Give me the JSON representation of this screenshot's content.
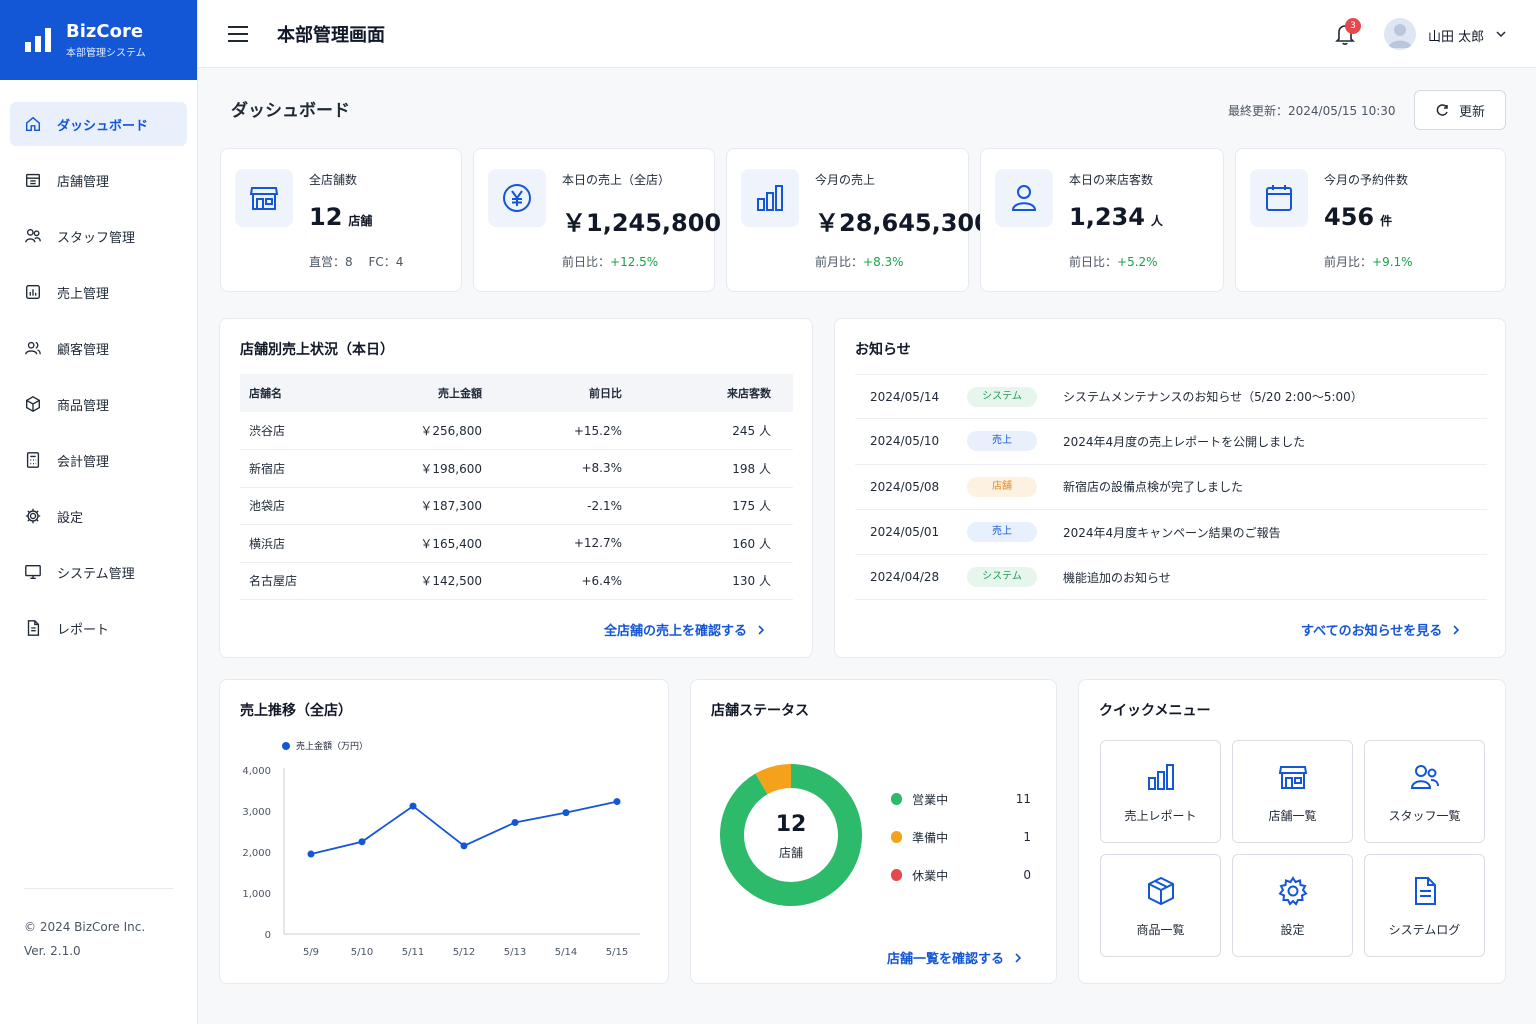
{
  "app": {
    "name": "BizCore",
    "subtitle": "本部管理システム"
  },
  "header": {
    "title": "本部管理画面",
    "notification_count": "3",
    "user_name": "山田 太郎"
  },
  "sidebar": {
    "items": [
      {
        "label": "ダッシュボード",
        "icon": "home-icon",
        "active": true
      },
      {
        "label": "店舗管理",
        "icon": "store-icon"
      },
      {
        "label": "スタッフ管理",
        "icon": "staff-icon"
      },
      {
        "label": "売上管理",
        "icon": "sales-chart-icon"
      },
      {
        "label": "顧客管理",
        "icon": "customers-icon"
      },
      {
        "label": "商品管理",
        "icon": "box-icon"
      },
      {
        "label": "会計管理",
        "icon": "calculator-icon"
      },
      {
        "label": "設定",
        "icon": "gear-icon"
      },
      {
        "label": "システム管理",
        "icon": "monitor-icon"
      },
      {
        "label": "レポート",
        "icon": "document-icon"
      }
    ],
    "copyright": "© 2024 BizCore Inc.",
    "version": "Ver. 2.1.0"
  },
  "page": {
    "title": "ダッシュボード",
    "last_updated": "最終更新：2024/05/15 10:30",
    "refresh_label": "更新"
  },
  "stats": [
    {
      "label": "全店舗数",
      "value": "12",
      "unit": "店舗",
      "sub": "直営：8　 FC：4",
      "icon": "store-icon"
    },
    {
      "label": "本日の売上（全店）",
      "value": "￥1,245,800",
      "unit": "",
      "sub_prefix": "前日比：",
      "sub_value": "+12.5%",
      "icon": "yen-icon"
    },
    {
      "label": "今月の売上",
      "value": "￥28,645,300",
      "unit": "",
      "sub_prefix": "前月比：",
      "sub_value": "+8.3%",
      "icon": "bar-chart-icon"
    },
    {
      "label": "本日の来店客数",
      "value": "1,234",
      "unit": "人",
      "sub_prefix": "前日比：",
      "sub_value": "+5.2%",
      "icon": "person-icon"
    },
    {
      "label": "今月の予約件数",
      "value": "456",
      "unit": "件",
      "sub_prefix": "前月比：",
      "sub_value": "+9.1%",
      "icon": "calendar-icon"
    }
  ],
  "store_sales": {
    "title": "店舗別売上状況（本日）",
    "columns": [
      "店舗名",
      "売上金額",
      "前日比",
      "来店客数"
    ],
    "rows": [
      {
        "store": "渋谷店",
        "amount": "￥256,800",
        "change": "+15.2%",
        "visitors": "245 人"
      },
      {
        "store": "新宿店",
        "amount": "￥198,600",
        "change": "+8.3%",
        "visitors": "198 人"
      },
      {
        "store": "池袋店",
        "amount": "￥187,300",
        "change": "-2.1%",
        "visitors": "175 人"
      },
      {
        "store": "横浜店",
        "amount": "￥165,400",
        "change": "+12.7%",
        "visitors": "160 人"
      },
      {
        "store": "名古屋店",
        "amount": "￥142,500",
        "change": "+6.4%",
        "visitors": "130 人"
      }
    ],
    "link": "全店舗の売上を確認する"
  },
  "notices": {
    "title": "お知らせ",
    "items": [
      {
        "date": "2024/05/14",
        "tag": "システム",
        "tag_color": "green",
        "text": "システムメンテナンスのお知らせ（5/20 2:00〜5:00）"
      },
      {
        "date": "2024/05/10",
        "tag": "売上",
        "tag_color": "blue",
        "text": "2024年4月度の売上レポートを公開しました"
      },
      {
        "date": "2024/05/08",
        "tag": "店舗",
        "tag_color": "orange",
        "text": "新宿店の設備点検が完了しました"
      },
      {
        "date": "2024/05/01",
        "tag": "売上",
        "tag_color": "blue",
        "text": "2024年4月度キャンペーン結果のご報告"
      },
      {
        "date": "2024/04/28",
        "tag": "システム",
        "tag_color": "green",
        "text": "機能追加のお知らせ"
      }
    ],
    "link": "すべてのお知らせを見る"
  },
  "chart_data": {
    "type": "line",
    "title": "売上推移（全店）",
    "legend": "売上金額（万円）",
    "categories": [
      "5/9",
      "5/10",
      "5/11",
      "5/12",
      "5/13",
      "5/14",
      "5/15"
    ],
    "series": [
      {
        "name": "売上金額（万円）",
        "values": [
          1950,
          2250,
          3120,
          2150,
          2720,
          2960,
          3230
        ],
        "color": "#1356d6"
      }
    ],
    "ylim": [
      0,
      4000
    ],
    "yticks": [
      "0",
      "1,000",
      "2,000",
      "3,000",
      "4,000"
    ],
    "grid": false
  },
  "store_status": {
    "title": "店舗ステータス",
    "total": "12",
    "total_label": "店舗",
    "items": [
      {
        "label": "営業中",
        "count": "11",
        "value": 11,
        "color": "#2dba6a"
      },
      {
        "label": "準備中",
        "count": "1",
        "value": 1,
        "color": "#f4a21c"
      },
      {
        "label": "休業中",
        "count": "0",
        "value": 0,
        "color": "#e5484d"
      }
    ],
    "link": "店舗一覧を確認する"
  },
  "quick_menu": {
    "title": "クイックメニュー",
    "items": [
      {
        "label": "売上レポート",
        "icon": "bar-chart-icon"
      },
      {
        "label": "店舗一覧",
        "icon": "store-icon"
      },
      {
        "label": "スタッフ一覧",
        "icon": "staff-icon"
      },
      {
        "label": "商品一覧",
        "icon": "box-icon"
      },
      {
        "label": "設定",
        "icon": "gear-icon"
      },
      {
        "label": "システムログ",
        "icon": "document-icon"
      }
    ]
  },
  "colors": {
    "brand": "#1356d6",
    "positive": "#16a34a",
    "negative": "#e5484d"
  }
}
